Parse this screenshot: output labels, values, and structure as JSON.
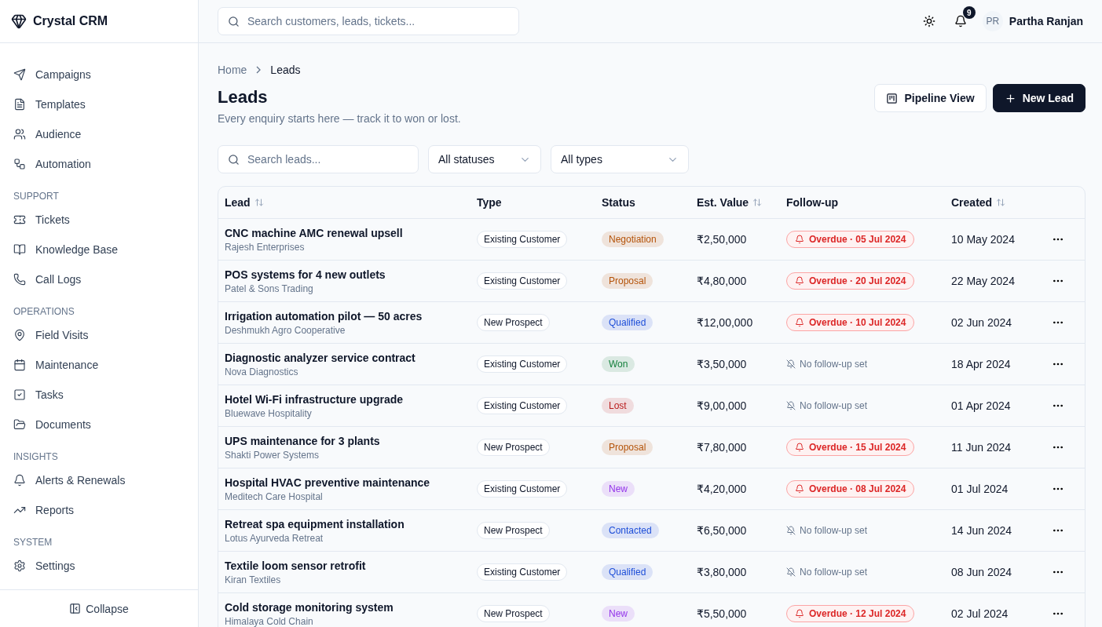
{
  "brand": {
    "name": "Crystal CRM"
  },
  "sidebar": {
    "sections": [
      {
        "items": [
          {
            "label": "Campaigns"
          },
          {
            "label": "Templates"
          },
          {
            "label": "Audience"
          },
          {
            "label": "Automation"
          }
        ]
      },
      {
        "heading": "SUPPORT",
        "items": [
          {
            "label": "Tickets"
          },
          {
            "label": "Knowledge Base"
          },
          {
            "label": "Call Logs"
          }
        ]
      },
      {
        "heading": "OPERATIONS",
        "items": [
          {
            "label": "Field Visits"
          },
          {
            "label": "Maintenance"
          },
          {
            "label": "Tasks"
          },
          {
            "label": "Documents"
          }
        ]
      },
      {
        "heading": "INSIGHTS",
        "items": [
          {
            "label": "Alerts & Renewals"
          },
          {
            "label": "Reports"
          }
        ]
      },
      {
        "heading": "SYSTEM",
        "items": [
          {
            "label": "Settings"
          }
        ]
      }
    ],
    "collapse": "Collapse"
  },
  "topbar": {
    "search": {
      "placeholder": "Search customers, leads, tickets..."
    },
    "notifications": "9",
    "user": {
      "initials": "PR",
      "name": "Partha Ranjan"
    }
  },
  "breadcrumb": [
    "Home",
    "Leads"
  ],
  "page": {
    "title": "Leads",
    "subtitle": "Every enquiry starts here — track it to won or lost.",
    "buttons": [
      {
        "label": "Pipeline View",
        "kind": "secondary"
      },
      {
        "label": "New Lead",
        "kind": "primary"
      }
    ]
  },
  "filters": {
    "search": {
      "placeholder": "Search leads..."
    },
    "selects": [
      "All statuses",
      "All types"
    ]
  },
  "table": {
    "columns": [
      {
        "label": "Lead",
        "sortable": true
      },
      {
        "label": "Type",
        "sortable": false
      },
      {
        "label": "Status",
        "sortable": false
      },
      {
        "label": "Est. Value",
        "sortable": true
      },
      {
        "label": "Follow-up",
        "sortable": false
      },
      {
        "label": "Created",
        "sortable": true
      }
    ],
    "rows": [
      {
        "lead": "CNC machine AMC renewal upsell",
        "company": "Rajesh Enterprises",
        "type": "Existing Customer",
        "status": {
          "label": "Negotiation",
          "color": "#b45309"
        },
        "value": "₹2,50,000",
        "followup": {
          "kind": "overdue",
          "label": "Overdue · 05 Jul 2024"
        },
        "created": "10 May 2024"
      },
      {
        "lead": "POS systems for 4 new outlets",
        "company": "Patel & Sons Trading",
        "type": "Existing Customer",
        "status": {
          "label": "Proposal",
          "color": "#b45309"
        },
        "value": "₹4,80,000",
        "followup": {
          "kind": "overdue",
          "label": "Overdue · 20 Jul 2024"
        },
        "created": "22 May 2024"
      },
      {
        "lead": "Irrigation automation pilot — 50 acres",
        "company": "Deshmukh Agro Cooperative",
        "type": "New Prospect",
        "status": {
          "label": "Qualified",
          "color": "#1d4ed8"
        },
        "value": "₹12,00,000",
        "followup": {
          "kind": "overdue",
          "label": "Overdue · 10 Jul 2024"
        },
        "created": "02 Jun 2024"
      },
      {
        "lead": "Diagnostic analyzer service contract",
        "company": "Nova Diagnostics",
        "type": "Existing Customer",
        "status": {
          "label": "Won",
          "color": "#15803d"
        },
        "value": "₹3,50,000",
        "followup": {
          "kind": "none",
          "label": "No follow-up set"
        },
        "created": "18 Apr 2024"
      },
      {
        "lead": "Hotel Wi-Fi infrastructure upgrade",
        "company": "Bluewave Hospitality",
        "type": "Existing Customer",
        "status": {
          "label": "Lost",
          "color": "#b91c1c"
        },
        "value": "₹9,00,000",
        "followup": {
          "kind": "none",
          "label": "No follow-up set"
        },
        "created": "01 Apr 2024"
      },
      {
        "lead": "UPS maintenance for 3 plants",
        "company": "Shakti Power Systems",
        "type": "New Prospect",
        "status": {
          "label": "Proposal",
          "color": "#b45309"
        },
        "value": "₹7,80,000",
        "followup": {
          "kind": "overdue",
          "label": "Overdue · 15 Jul 2024"
        },
        "created": "11 Jun 2024"
      },
      {
        "lead": "Hospital HVAC preventive maintenance",
        "company": "Meditech Care Hospital",
        "type": "Existing Customer",
        "status": {
          "label": "New",
          "color": "#9333ea"
        },
        "value": "₹4,20,000",
        "followup": {
          "kind": "overdue",
          "label": "Overdue · 08 Jul 2024"
        },
        "created": "01 Jul 2024"
      },
      {
        "lead": "Retreat spa equipment installation",
        "company": "Lotus Ayurveda Retreat",
        "type": "New Prospect",
        "status": {
          "label": "Contacted",
          "color": "#1d4ed8"
        },
        "value": "₹6,50,000",
        "followup": {
          "kind": "none",
          "label": "No follow-up set"
        },
        "created": "14 Jun 2024"
      },
      {
        "lead": "Textile loom sensor retrofit",
        "company": "Kiran Textiles",
        "type": "Existing Customer",
        "status": {
          "label": "Qualified",
          "color": "#1d4ed8"
        },
        "value": "₹3,80,000",
        "followup": {
          "kind": "none",
          "label": "No follow-up set"
        },
        "created": "08 Jun 2024"
      },
      {
        "lead": "Cold storage monitoring system",
        "company": "Himalaya Cold Chain",
        "type": "New Prospect",
        "status": {
          "label": "New",
          "color": "#9333ea"
        },
        "value": "₹5,50,000",
        "followup": {
          "kind": "overdue",
          "label": "Overdue · 12 Jul 2024"
        },
        "created": "02 Jul 2024"
      }
    ]
  }
}
